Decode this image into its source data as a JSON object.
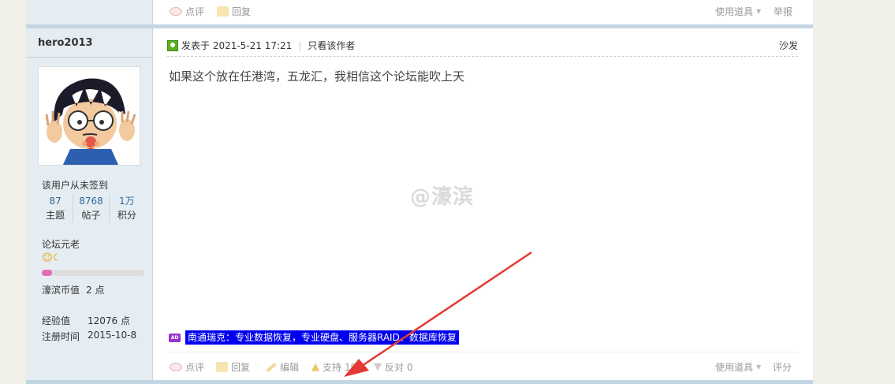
{
  "prev_post": {
    "footer": {
      "comment_label": "点评",
      "reply_label": "回复",
      "tools_label": "使用道具",
      "report_label": "举报"
    }
  },
  "author": {
    "name": "hero2013",
    "sign_note": "该用户从未签到",
    "stats": [
      {
        "num": "87",
        "label": "主题"
      },
      {
        "num": "8768",
        "label": "帖子"
      },
      {
        "num": "1万",
        "label": "积分"
      }
    ],
    "rank_title": "论坛元老",
    "rank_icons": "☺☾",
    "rank_progress": 0.1,
    "coins": {
      "label": "濠滨币值",
      "value": "2 点"
    },
    "exp": {
      "label": "经验值",
      "value": "12076 点"
    },
    "reg": {
      "label": "注册时间",
      "value": "2015-10-8"
    }
  },
  "post": {
    "posted_at": "发表于 2021-5-21 17:21",
    "only_author_label": "只看该作者",
    "floor_label": "沙发",
    "content": "如果这个放在任港湾，五龙汇，我相信这个论坛能吹上天",
    "watermark": "@濠滨",
    "ad_badge": "AD",
    "ad_text": "南通瑞克：专业数据恢复，专业硬盘、服务器RAID、数据库恢复",
    "footer": {
      "comment_label": "点评",
      "reply_label": "回复",
      "edit_label": "编辑",
      "support_label": "支持",
      "support_count": "19",
      "oppose_label": "反对",
      "oppose_count": "0",
      "tools_label": "使用道具",
      "rate_label": "评分"
    }
  },
  "colors": {
    "sidebar_bg": "#e5edf2",
    "separator": "#c2d5e3",
    "ad_bg": "#0000ee",
    "annotation_arrow": "#e53935"
  }
}
